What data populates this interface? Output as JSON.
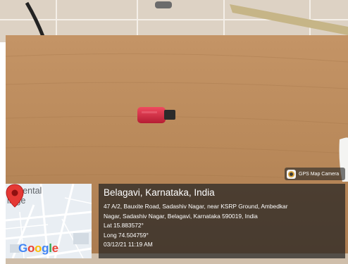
{
  "badge": {
    "text": "GPS Map Camera",
    "icon": "camera-app-icon"
  },
  "map": {
    "label_line1": "al Dental",
    "label_line2": "llege",
    "google_letters": [
      "G",
      "o",
      "o",
      "g",
      "l",
      "e"
    ],
    "pin_color": "#e53935"
  },
  "location": {
    "title": "Belagavi, Karnataka, India",
    "address_line1": "47 A/2, Bauxite Road, Sadashiv Nagar, near KSRP Ground, Ambedkar",
    "address_line2": "Nagar, Sadashiv Nagar, Belagavi, Karnataka 590019, India",
    "lat": "Lat 15.883572°",
    "long": "Long 74.504759°",
    "datetime": "03/12/21 11:19 AM"
  },
  "colors": {
    "table_wood": "#b98a58",
    "usb_drive": "#d62840"
  }
}
